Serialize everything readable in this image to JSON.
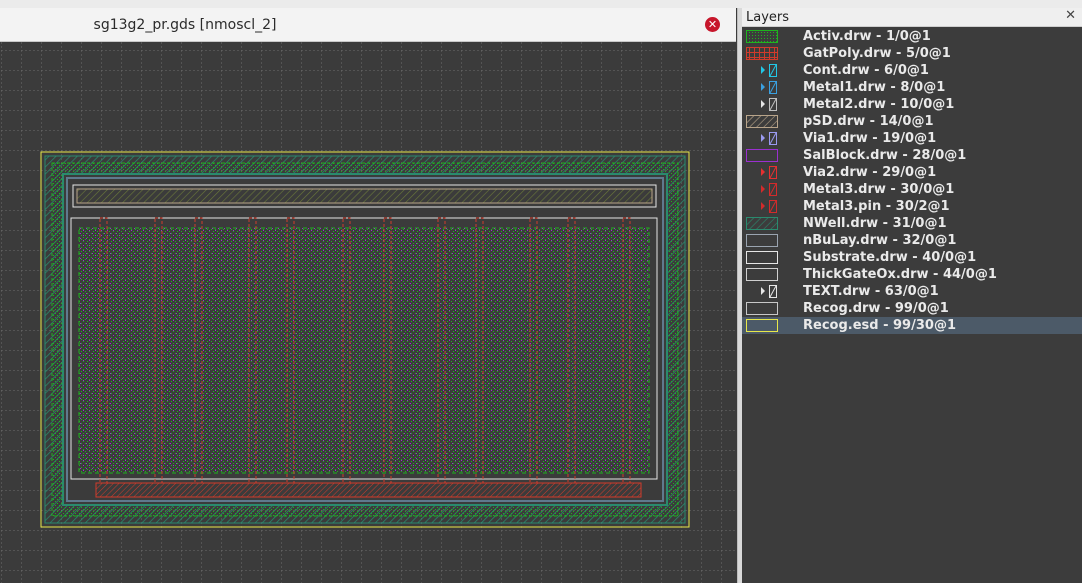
{
  "window": {
    "tab_title": "sg13g2_pr.gds [nmoscl_2]"
  },
  "layers_panel": {
    "title": "Layers",
    "close_glyph": "✕",
    "selected_index": 17,
    "items": [
      {
        "label": "Activ.drw - 1/0@1",
        "color": "#1fb31f",
        "pattern": "dots",
        "arrow": false
      },
      {
        "label": "GatPoly.drw - 5/0@1",
        "color": "#d23b2b",
        "pattern": "cross",
        "arrow": false
      },
      {
        "label": "Cont.drw - 6/0@1",
        "color": "#22c7e6",
        "pattern": "slash",
        "arrow": true,
        "small": true
      },
      {
        "label": "Metal1.drw - 8/0@1",
        "color": "#3aa0e0",
        "pattern": "slash",
        "arrow": true,
        "small": true
      },
      {
        "label": "Metal2.drw - 10/0@1",
        "color": "#c0c0c0",
        "pattern": "slash",
        "arrow": true,
        "small": true
      },
      {
        "label": "pSD.drw - 14/0@1",
        "color": "#b8a48a",
        "pattern": "hatch",
        "arrow": false
      },
      {
        "label": "Via1.drw - 19/0@1",
        "color": "#9a9af0",
        "pattern": "slash",
        "arrow": true,
        "small": true
      },
      {
        "label": "SalBlock.drw - 28/0@1",
        "color": "#9b30d0",
        "pattern": "none",
        "arrow": false
      },
      {
        "label": "Via2.drw - 29/0@1",
        "color": "#e53030",
        "pattern": "slash",
        "arrow": true,
        "small": true
      },
      {
        "label": "Metal3.drw - 30/0@1",
        "color": "#d22b2b",
        "pattern": "slash",
        "arrow": true,
        "small": true
      },
      {
        "label": "Metal3.pin - 30/2@1",
        "color": "#d22b2b",
        "pattern": "slash",
        "arrow": true,
        "small": true
      },
      {
        "label": "NWell.drw - 31/0@1",
        "color": "#2a8a6e",
        "pattern": "hatch",
        "arrow": false
      },
      {
        "label": "nBuLay.drw - 32/0@1",
        "color": "#9aa4b0",
        "pattern": "none",
        "arrow": false
      },
      {
        "label": "Substrate.drw - 40/0@1",
        "color": "#e6e6e6",
        "pattern": "none",
        "arrow": false
      },
      {
        "label": "ThickGateOx.drw - 44/0@1",
        "color": "#d0d0d0",
        "pattern": "none",
        "arrow": false
      },
      {
        "label": "TEXT.drw - 63/0@1",
        "color": "#e6e6e6",
        "pattern": "none",
        "arrow": true,
        "small": true
      },
      {
        "label": "Recog.drw - 99/0@1",
        "color": "#c8c8c8",
        "pattern": "none",
        "arrow": false
      },
      {
        "label": "Recog.esd - 99/30@1",
        "color": "#e8e84a",
        "pattern": "none",
        "arrow": false
      }
    ]
  },
  "colors": {
    "grid": "#6e6e6e",
    "activ": "#1fb31f",
    "gatpoly": "#d23b2b",
    "salblock": "#9b30d0",
    "nwell": "#2a8a6e",
    "nbulay": "#5f7a8e",
    "recog_esd": "#e8e84a",
    "substrate": "#e6e6e6"
  }
}
